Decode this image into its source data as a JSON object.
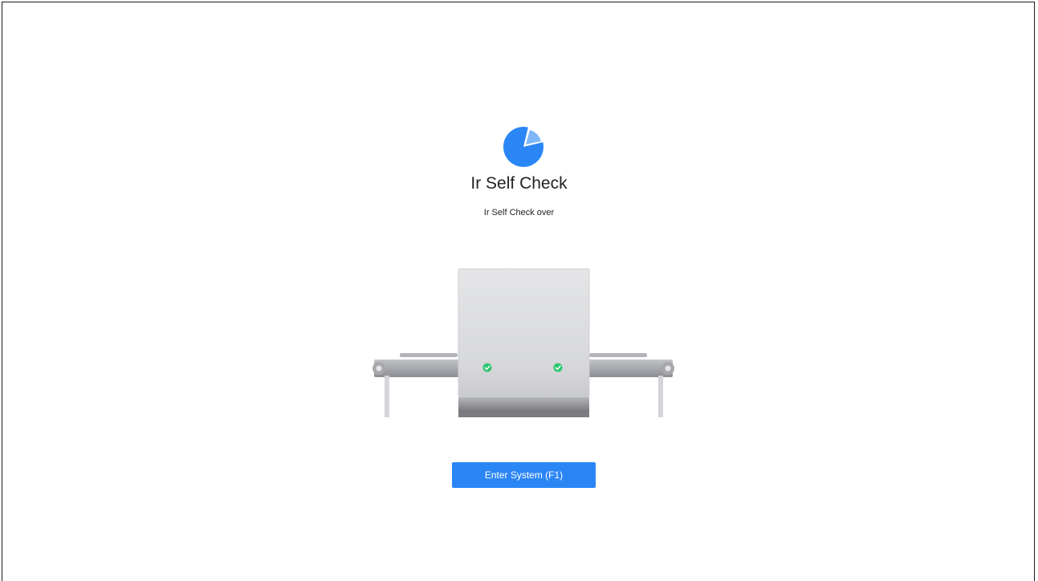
{
  "self_check": {
    "title": "Ir Self Check",
    "status": "Ir Self Check over",
    "logo_icon": "pie-chart-icon",
    "machine_icon": "xray-scanner-illustration",
    "check_indicators": [
      "check-ok-icon",
      "check-ok-icon"
    ]
  },
  "actions": {
    "enter_label": "Enter System (F1)"
  },
  "colors": {
    "accent": "#2b86f5",
    "success": "#2cc66f",
    "background": "#ffffff"
  }
}
